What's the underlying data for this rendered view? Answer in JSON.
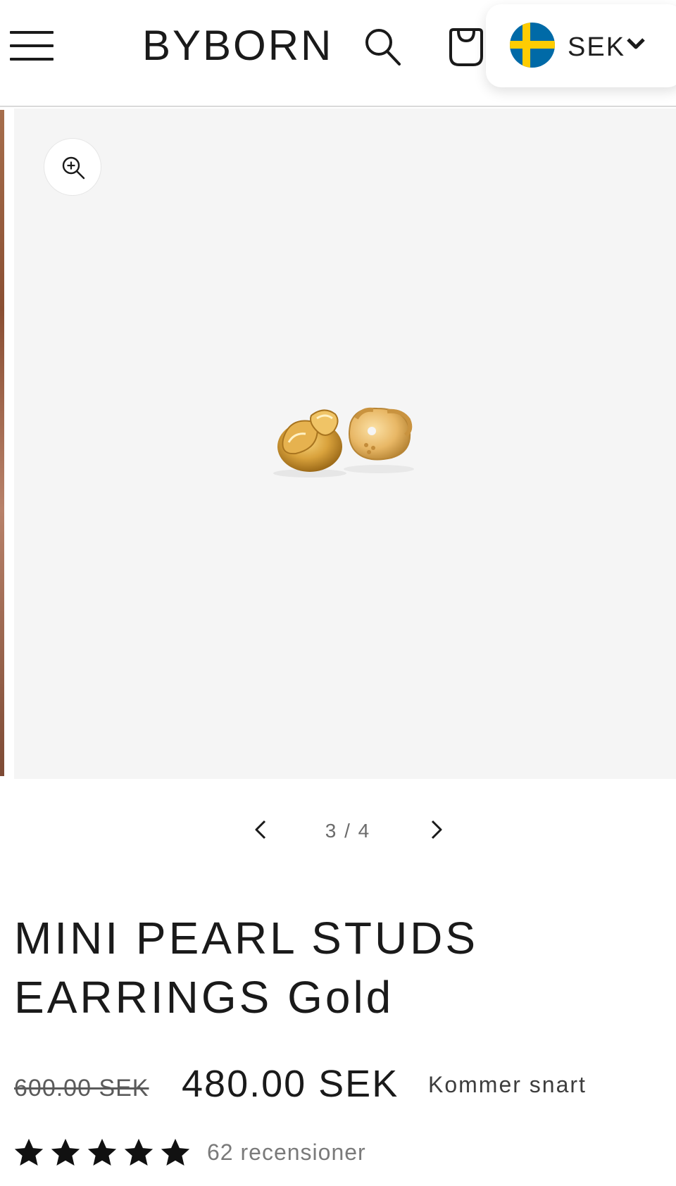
{
  "header": {
    "logo_text": "BYBORN",
    "menu_icon": "hamburger-menu-icon",
    "search_icon": "search-icon",
    "cart_icon": "shopping-bag-icon",
    "currency": {
      "code": "SEK",
      "flag": "sweden-flag-icon",
      "chevron_icon": "chevron-down-icon"
    }
  },
  "gallery": {
    "zoom_icon": "zoom-in-icon",
    "image_alt": "Gold earring backs",
    "counter": "3 / 4",
    "prev_icon": "chevron-left-icon",
    "next_icon": "chevron-right-icon"
  },
  "product": {
    "title_line1": "MINI PEARL STUDS",
    "title_line2": "EARRINGS Gold",
    "old_price": "600.00 SEK",
    "price": "480.00 SEK",
    "availability": "Kommer snart",
    "rating_stars": 5,
    "reviews_label": "62 recensioner"
  },
  "colors": {
    "text": "#1a1a1a",
    "gallery_bg": "#f5f5f5",
    "flag_blue": "#006aa7",
    "flag_yellow": "#fecc02",
    "gold": "#d9a844"
  }
}
